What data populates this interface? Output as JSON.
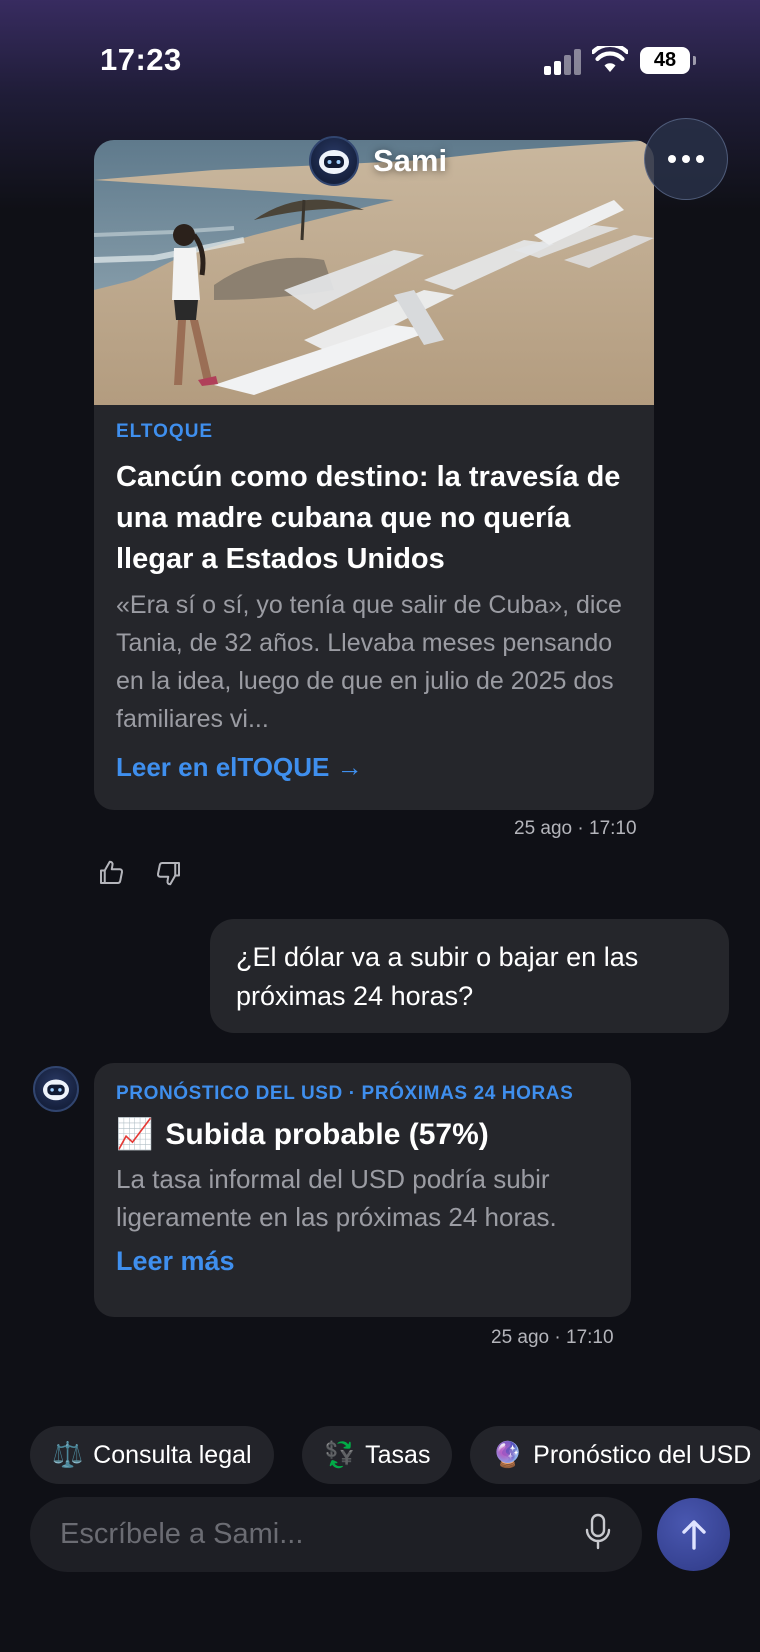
{
  "status_bar": {
    "time": "17:23",
    "battery": "48"
  },
  "header": {
    "title": "Sami",
    "more_icon": "ellipsis-icon"
  },
  "article": {
    "source": "ELTOQUE",
    "title": "Cancún como destino: la travesía de una madre cubana que no quería llegar a Estados Unidos",
    "description": "«Era sí o sí, yo tenía que salir de Cuba», dice Tania, de 32 años. Llevaba meses pensando en la idea, luego de que en julio de 2025 dos familiares vi...",
    "link": "Leer en elTOQUE →",
    "timestamp": "25 ago · 17:10"
  },
  "user_message": {
    "text": "¿El dólar va a subir o bajar en las próximas 24 horas?"
  },
  "forecast": {
    "label": "PRONÓSTICO DEL USD · PRÓXIMAS 24 HORAS",
    "emoji": "📈",
    "title": "Subida probable (57%)",
    "description": "La tasa informal del USD podría subir ligeramente en las próximas 24 horas.",
    "link": "Leer más",
    "timestamp": "25 ago · 17:10"
  },
  "chips": [
    {
      "icon": "⚖️",
      "label": "Consulta legal"
    },
    {
      "icon": "💱",
      "label": "Tasas"
    },
    {
      "icon": "🔮",
      "label": "Pronóstico del USD"
    }
  ],
  "input": {
    "placeholder": "Escríbele a Sami..."
  },
  "colors": {
    "accent": "#3f8fee",
    "background": "#0f1016",
    "card": "#25262b"
  }
}
